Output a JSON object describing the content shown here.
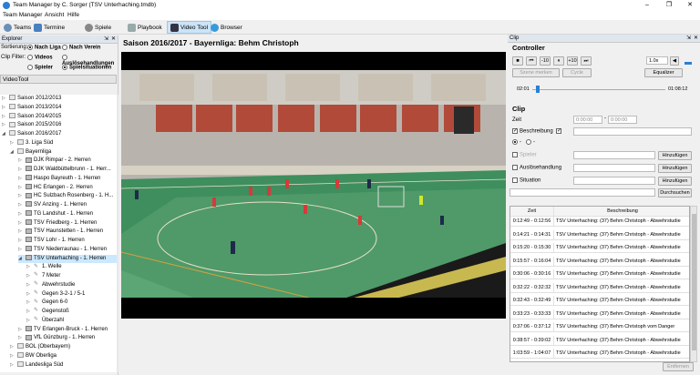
{
  "window": {
    "title": "Team Manager by C. Sorger (TSV Unterhaching.tmdb)"
  },
  "menu": [
    "Team Manager",
    "Ansicht",
    "Hilfe"
  ],
  "toolbar": {
    "items": [
      "Teams",
      "Termine",
      "Spiele",
      "Playbook",
      "Video Tool",
      "Browser"
    ]
  },
  "explorer": {
    "title": "Explorer",
    "sort_label": "Sortierung:",
    "sort_liga": "Nach Liga",
    "sort_verein": "Nach Verein",
    "filter_label": "Clip Filter:",
    "f_videos": "Videos",
    "f_ausloese": "Auslösehandlungen",
    "f_spieler": "Spieler",
    "f_spielsituationen": "Spielsituationen",
    "tab": "VideoTool"
  },
  "tree": [
    {
      "label": "Saison 2012/2013",
      "level": 0,
      "arrow": "▷",
      "icon": "folder"
    },
    {
      "label": "Saison 2013/2014",
      "level": 0,
      "arrow": "▷",
      "icon": "folder"
    },
    {
      "label": "Saison 2014/2015",
      "level": 0,
      "arrow": "▷",
      "icon": "folder"
    },
    {
      "label": "Saison 2015/2016",
      "level": 0,
      "arrow": "▷",
      "icon": "folder"
    },
    {
      "label": "Saison 2016/2017",
      "level": 0,
      "arrow": "◢",
      "icon": "folder"
    },
    {
      "label": "3. Liga Süd",
      "level": 1,
      "arrow": "▷",
      "icon": "folder"
    },
    {
      "label": "Bayernliga",
      "level": 1,
      "arrow": "◢",
      "icon": "folder"
    },
    {
      "label": "DJK Rimpar - 2. Herren",
      "level": 2,
      "arrow": "▷",
      "icon": "team"
    },
    {
      "label": "DJK Waldbüttelbrunn - 1. Herr...",
      "level": 2,
      "arrow": "▷",
      "icon": "team"
    },
    {
      "label": "Haspo Bayreuth - 1. Herren",
      "level": 2,
      "arrow": "▷",
      "icon": "team"
    },
    {
      "label": "HC Erlangen - 2. Herren",
      "level": 2,
      "arrow": "▷",
      "icon": "team"
    },
    {
      "label": "HC Sulzbach Rosenberg - 1. H...",
      "level": 2,
      "arrow": "▷",
      "icon": "team"
    },
    {
      "label": "SV Anzing - 1. Herren",
      "level": 2,
      "arrow": "▷",
      "icon": "team"
    },
    {
      "label": "TG Landshut - 1. Herren",
      "level": 2,
      "arrow": "▷",
      "icon": "team"
    },
    {
      "label": "TSV Friedberg - 1. Herren",
      "level": 2,
      "arrow": "▷",
      "icon": "team"
    },
    {
      "label": "TSV Haunstetten - 1. Herren",
      "level": 2,
      "arrow": "▷",
      "icon": "team"
    },
    {
      "label": "TSV Lohr - 1. Herren",
      "level": 2,
      "arrow": "▷",
      "icon": "team"
    },
    {
      "label": "TSV Niederraunau - 1. Herren",
      "level": 2,
      "arrow": "▷",
      "icon": "team"
    },
    {
      "label": "TSV Unterhaching - 1. Herren",
      "level": 2,
      "arrow": "◢",
      "icon": "team",
      "selected": true
    },
    {
      "label": "1. Welle",
      "level": 3,
      "arrow": "▷",
      "icon": "clip"
    },
    {
      "label": "7 Meter",
      "level": 3,
      "arrow": "▷",
      "icon": "clip"
    },
    {
      "label": "Abwehrstudie",
      "level": 3,
      "arrow": "▷",
      "icon": "clip"
    },
    {
      "label": "Gegen 3-2-1 / 5-1",
      "level": 3,
      "arrow": "▷",
      "icon": "clip"
    },
    {
      "label": "Gegen 6-0",
      "level": 3,
      "arrow": "▷",
      "icon": "clip"
    },
    {
      "label": "Gegenstoß",
      "level": 3,
      "arrow": "▷",
      "icon": "clip"
    },
    {
      "label": "Überzahl",
      "level": 3,
      "arrow": "▷",
      "icon": "clip"
    },
    {
      "label": "TV Erlangen-Bruck - 1. Herren",
      "level": 2,
      "arrow": "▷",
      "icon": "team"
    },
    {
      "label": "VfL Günzburg - 1. Herren",
      "level": 2,
      "arrow": "▷",
      "icon": "team"
    },
    {
      "label": "BOL (Oberbayern)",
      "level": 1,
      "arrow": "▷",
      "icon": "folder"
    },
    {
      "label": "BW Oberliga",
      "level": 1,
      "arrow": "▷",
      "icon": "folder"
    },
    {
      "label": "Landesliga Süd",
      "level": 1,
      "arrow": "▷",
      "icon": "folder"
    }
  ],
  "main": {
    "title": "Saison 2016/2017 - Bayernliga:   Behm Christoph"
  },
  "clip_panel": {
    "title": "Clip",
    "controller_title": "Controller",
    "btn_m10": "-10",
    "btn_p10": "+10",
    "speed": "1.0x",
    "szene_merken": "Szene merken",
    "cycle": "Cycle",
    "equalizer": "Equalizer",
    "time_start": "02:01",
    "time_end": "01:08:12",
    "progress": 0.03,
    "clip_title": "Clip",
    "zeit_label": "Zeit",
    "zeit_from": "0:00:00",
    "zeit_to": "0:00:00",
    "beschreibung_label": "Beschreibung",
    "spieler_label": "Spieler",
    "ausloese_label": "Auslösehandlung",
    "situation_label": "Situation",
    "hinzufuegen": "Hinzufügen",
    "durchsuchen": "Durchsuchen",
    "entfernen": "Entfernen"
  },
  "table": {
    "col_zeit": "Zeit",
    "col_beschreibung": "Beschreibung",
    "rows": [
      {
        "zeit": "0:12:49 - 0:12:56",
        "desc": "TSV Unterhaching: (37) Behm Christoph - Abwehrstudie"
      },
      {
        "zeit": "0:14:21 - 0:14:31",
        "desc": "TSV Unterhaching: (37) Behm Christoph - Abwehrstudie"
      },
      {
        "zeit": "0:15:20 - 0:15:30",
        "desc": "TSV Unterhaching: (37) Behm Christoph - Abwehrstudie"
      },
      {
        "zeit": "0:15:57 - 0:16:04",
        "desc": "TSV Unterhaching: (37) Behm Christoph - Abwehrstudie"
      },
      {
        "zeit": "0:30:06 - 0:30:16",
        "desc": "TSV Unterhaching: (37) Behm Christoph - Abwehrstudie"
      },
      {
        "zeit": "0:32:22 - 0:32:32",
        "desc": "TSV Unterhaching: (37) Behm Christoph - Abwehrstudie"
      },
      {
        "zeit": "0:32:43 - 0:32:49",
        "desc": "TSV Unterhaching: (37) Behm Christoph - Abwehrstudie"
      },
      {
        "zeit": "0:33:23 - 0:33:33",
        "desc": "TSV Unterhaching: (37) Behm Christoph - Abwehrstudie"
      },
      {
        "zeit": "0:37:06 - 0:37:12",
        "desc": "TSV Unterhaching: (37) Behm Christoph vom Danger"
      },
      {
        "zeit": "0:38:57 - 0:39:02",
        "desc": "TSV Unterhaching: (37) Behm Christoph - Abwehrstudie"
      },
      {
        "zeit": "1:03:59 - 1:04:07",
        "desc": "TSV Unterhaching: (37) Behm Christoph - Abwehrstudie"
      }
    ]
  }
}
